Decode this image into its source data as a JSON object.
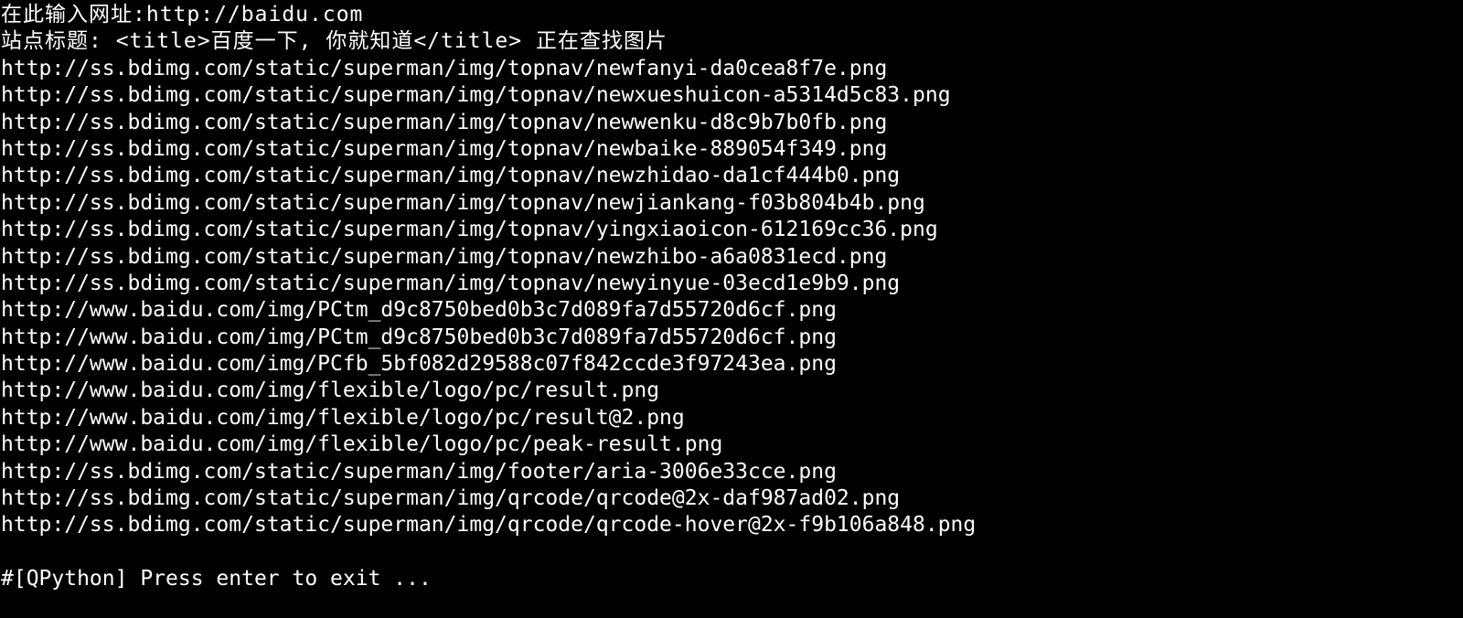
{
  "terminal": {
    "url_prompt": "在此输入网址:http://baidu.com",
    "title_line": "站点标题: <title>百度一下, 你就知道</title> 正在查找图片",
    "urls": [
      "http://ss.bdimg.com/static/superman/img/topnav/newfanyi-da0cea8f7e.png",
      "http://ss.bdimg.com/static/superman/img/topnav/newxueshuicon-a5314d5c83.png",
      "http://ss.bdimg.com/static/superman/img/topnav/newwenku-d8c9b7b0fb.png",
      "http://ss.bdimg.com/static/superman/img/topnav/newbaike-889054f349.png",
      "http://ss.bdimg.com/static/superman/img/topnav/newzhidao-da1cf444b0.png",
      "http://ss.bdimg.com/static/superman/img/topnav/newjiankang-f03b804b4b.png",
      "http://ss.bdimg.com/static/superman/img/topnav/yingxiaoicon-612169cc36.png",
      "http://ss.bdimg.com/static/superman/img/topnav/newzhibo-a6a0831ecd.png",
      "http://ss.bdimg.com/static/superman/img/topnav/newyinyue-03ecd1e9b9.png",
      "http://www.baidu.com/img/PCtm_d9c8750bed0b3c7d089fa7d55720d6cf.png",
      "http://www.baidu.com/img/PCtm_d9c8750bed0b3c7d089fa7d55720d6cf.png",
      "http://www.baidu.com/img/PCfb_5bf082d29588c07f842ccde3f97243ea.png",
      "http://www.baidu.com/img/flexible/logo/pc/result.png",
      "http://www.baidu.com/img/flexible/logo/pc/result@2.png",
      "http://www.baidu.com/img/flexible/logo/pc/peak-result.png",
      "http://ss.bdimg.com/static/superman/img/footer/aria-3006e33cce.png",
      "http://ss.bdimg.com/static/superman/img/qrcode/qrcode@2x-daf987ad02.png",
      "http://ss.bdimg.com/static/superman/img/qrcode/qrcode-hover@2x-f9b106a848.png"
    ],
    "exit_prompt": "#[QPython] Press enter to exit ..."
  },
  "colors": {
    "background": "#000000",
    "foreground": "#ffffff"
  }
}
